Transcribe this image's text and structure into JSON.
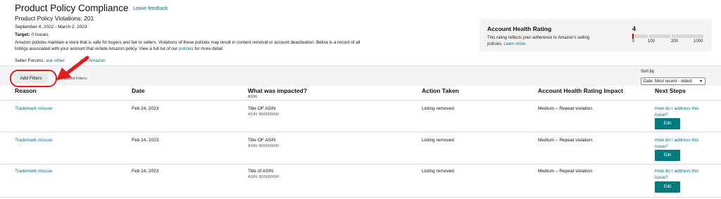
{
  "header": {
    "title": "Product Policy Compliance",
    "feedback_link": "Leave feedback",
    "violations": "Product Policy Violations: 201",
    "date_range": "September 4, 2022 - March 2, 2023",
    "target_label": "Target:",
    "target_value": "0 Issues",
    "description_1": "Amazon policies maintain a store that is safe for buyers and fair to sellers. Violations of these policies may result in content removal or account deactivation. Below is a",
    "description_2": "record of all listings associated with your account that violate Amazon policy. View a full list of our",
    "policies_link": "policies",
    "description_3": "for more detail.",
    "forums_label": "Seller Forums:",
    "forums_link_1": "ask other",
    "forums_link_2": "and Amazon"
  },
  "health": {
    "title": "Account Health Rating",
    "text": "This rating reflects your adherence to Amazon's selling policies.",
    "learn_more": "Learn more.",
    "score": "4",
    "ticks": [
      "0",
      "100",
      "200",
      "1000"
    ],
    "marker_color": "#c40000"
  },
  "filters": {
    "add_filters": "Add Filters",
    "applied": "Applied Filters:",
    "sort_label": "Sort by",
    "sort_value": "Date: Most recent - oldest"
  },
  "table": {
    "headers": {
      "reason": "Reason",
      "date": "Date",
      "impacted": "What was impacted?",
      "impacted_sub": "ASIN",
      "action": "Action Taken",
      "ahr_impact": "Account Health Rating Impact",
      "next": "Next Steps"
    },
    "rows": [
      {
        "reason": "Trademark misuse",
        "date": "Feb 24, 2023",
        "title": "Title OF ASIN",
        "asin": "ASIN: B00000000",
        "action": "Listing removed",
        "impact": "Medium – Repeat violation",
        "next_link": "How do I address this issue?",
        "edit": "Edit"
      },
      {
        "reason": "Trademark misuse",
        "date": "Feb 24, 2023",
        "title": "Title OF ASIN",
        "asin": "ASIN: B00000000",
        "action": "Listing removed",
        "impact": "Medium – Repeat violation",
        "next_link": "How do I address this issue?",
        "edit": "Edit"
      },
      {
        "reason": "Trademark misuse",
        "date": "Feb 24, 2023",
        "title": "Title of ASIN",
        "asin": "ASIN: B00000000",
        "action": "Listing removed",
        "impact": "Medium – Repeat violation",
        "next_link": "How do I address this issue?",
        "edit": "Edit"
      }
    ]
  },
  "colors": {
    "link": "#007185",
    "edit_button": "#00797f",
    "annotation": "#e31b1b"
  }
}
